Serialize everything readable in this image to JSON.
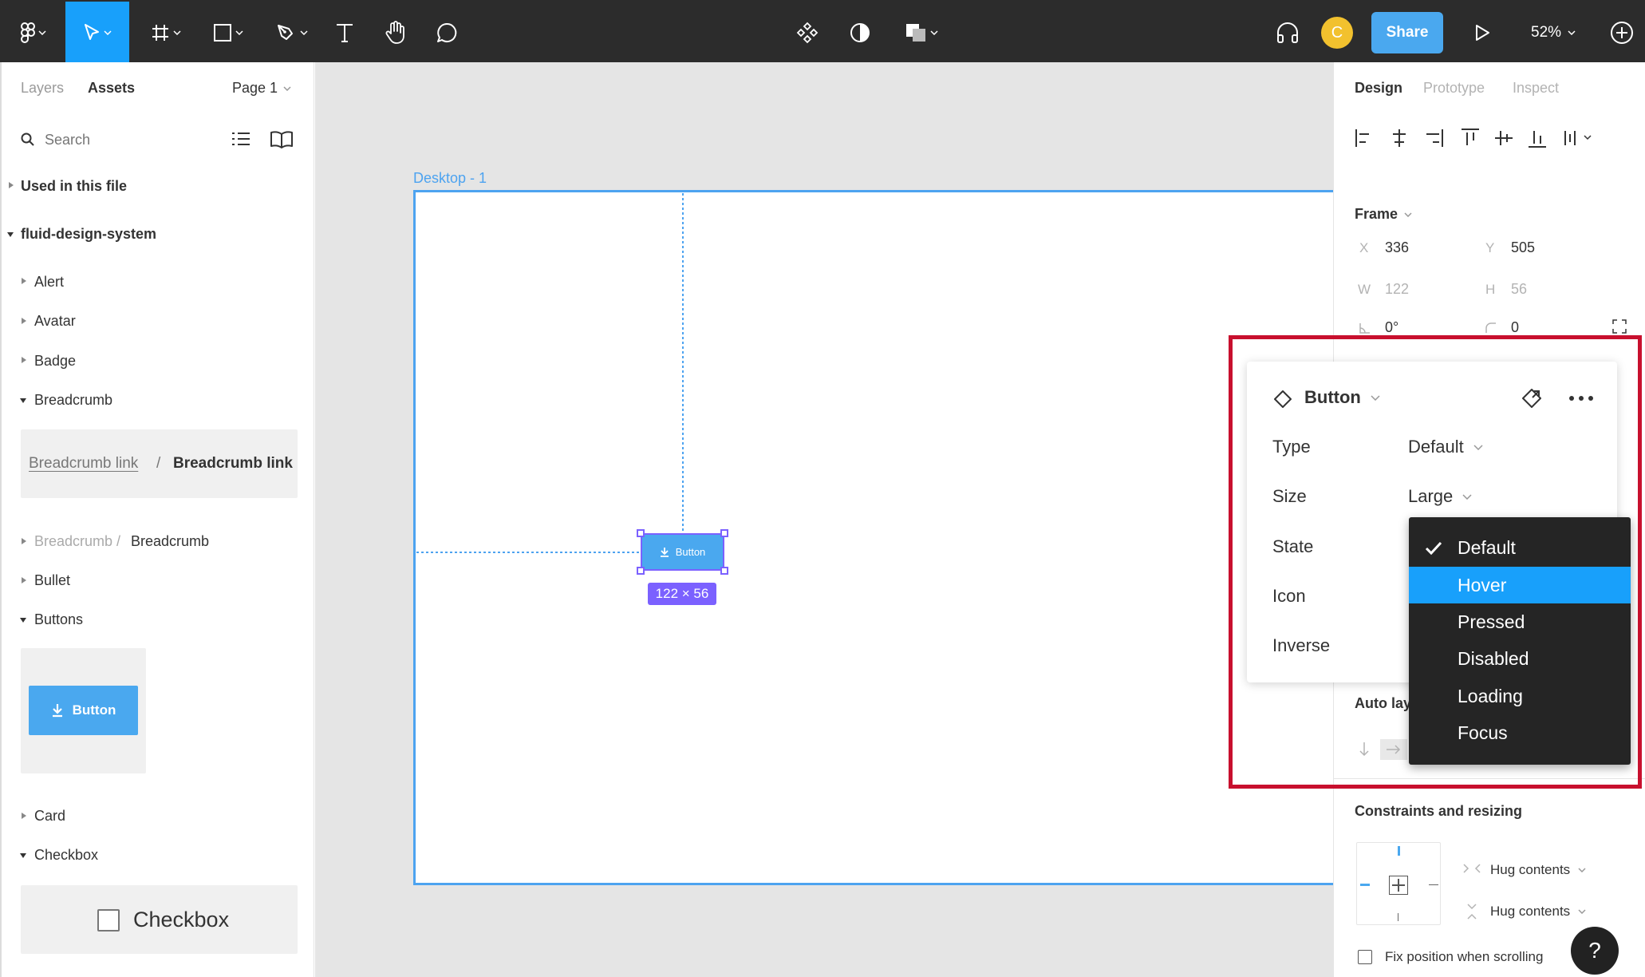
{
  "toolbar": {
    "share_label": "Share",
    "avatar_initial": "C",
    "zoom": "52%"
  },
  "left_panel": {
    "tabs": {
      "layers": "Layers",
      "assets": "Assets"
    },
    "page": "Page 1",
    "search_placeholder": "Search",
    "used_in_file": "Used in this file",
    "library": "fluid-design-system",
    "items": {
      "alert": "Alert",
      "avatar": "Avatar",
      "badge": "Badge",
      "breadcrumb": "Breadcrumb",
      "breadcrumb_sub_parent": "Breadcrumb /",
      "breadcrumb_sub_child": "Breadcrumb",
      "bullet": "Bullet",
      "buttons": "Buttons",
      "card": "Card",
      "checkbox": "Checkbox"
    },
    "breadcrumb_thumb": {
      "link1": "Breadcrumb link",
      "sep": "/",
      "link2": "Breadcrumb link"
    },
    "button_thumb": {
      "label": "Button"
    },
    "checkbox_thumb": {
      "label": "Checkbox"
    }
  },
  "canvas": {
    "frame_name": "Desktop - 1",
    "button_label": "Button",
    "size_badge": "122 × 56"
  },
  "right_panel": {
    "tabs": {
      "design": "Design",
      "prototype": "Prototype",
      "inspect": "Inspect"
    },
    "frame_header": "Frame",
    "x_label": "X",
    "x_value": "336",
    "y_label": "Y",
    "y_value": "505",
    "w_label": "W",
    "w_value": "122",
    "h_label": "H",
    "h_value": "56",
    "rotation": "0°",
    "radius": "0",
    "auto_layout_partial": "Auto lay",
    "constraints_header": "Constraints and resizing",
    "hug_1": "Hug contents",
    "hug_2": "Hug contents",
    "fix_position": "Fix position when scrolling",
    "help": "?"
  },
  "popup": {
    "title": "Button",
    "props": {
      "type_label": "Type",
      "type_value": "Default",
      "size_label": "Size",
      "size_value": "Large",
      "state_label": "State",
      "icon_label": "Icon",
      "inverse_label": "Inverse"
    },
    "dropdown": {
      "options": [
        "Default",
        "Hover",
        "Pressed",
        "Disabled",
        "Loading",
        "Focus"
      ],
      "checked": "Default",
      "highlighted": "Hover"
    }
  },
  "colors": {
    "accent": "#18a0fb",
    "toolbar_bg": "#2c2c2c",
    "highlight_border": "#c8102e",
    "avatar": "#f2c12e",
    "size_badge": "#7b61ff"
  }
}
